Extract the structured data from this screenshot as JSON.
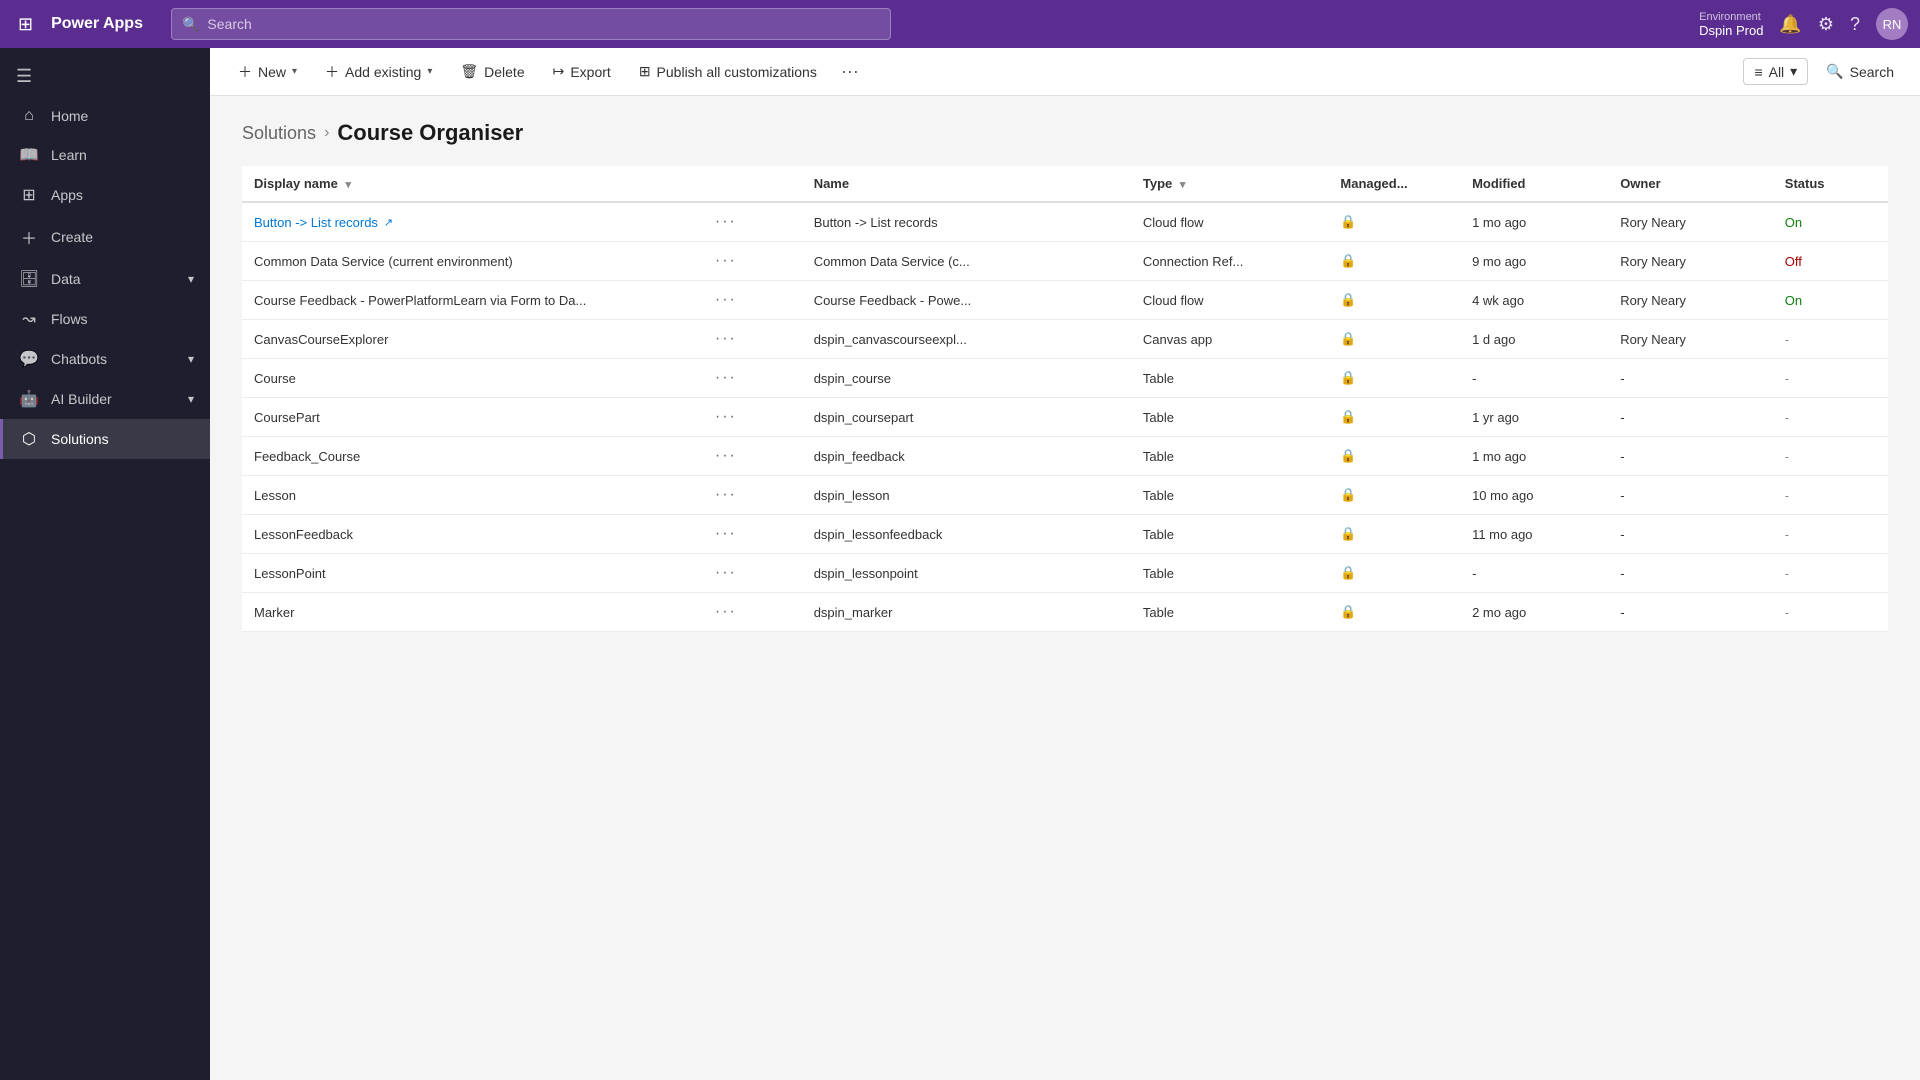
{
  "app": {
    "title": "Power Apps",
    "grid_icon": "⊞"
  },
  "topnav": {
    "search_placeholder": "Search",
    "environment_label": "Environment",
    "environment_name": "Dspin Prod",
    "avatar_initials": "RN"
  },
  "sidebar": {
    "toggle_icon": "☰",
    "items": [
      {
        "id": "home",
        "label": "Home",
        "icon": "⌂",
        "active": false
      },
      {
        "id": "learn",
        "label": "Learn",
        "icon": "📖",
        "active": false
      },
      {
        "id": "apps",
        "label": "Apps",
        "icon": "⊞",
        "active": false
      },
      {
        "id": "create",
        "label": "Create",
        "icon": "+",
        "active": false
      },
      {
        "id": "data",
        "label": "Data",
        "icon": "🗄",
        "active": false,
        "has_chevron": true
      },
      {
        "id": "flows",
        "label": "Flows",
        "icon": "↝",
        "active": false
      },
      {
        "id": "chatbots",
        "label": "Chatbots",
        "icon": "💬",
        "active": false,
        "has_chevron": true
      },
      {
        "id": "ai-builder",
        "label": "AI Builder",
        "icon": "🤖",
        "active": false,
        "has_chevron": true
      },
      {
        "id": "solutions",
        "label": "Solutions",
        "icon": "⬡",
        "active": true
      }
    ]
  },
  "cmdbar": {
    "new_label": "New",
    "add_existing_label": "Add existing",
    "delete_label": "Delete",
    "export_label": "Export",
    "publish_label": "Publish all customizations",
    "more_icon": "···",
    "filter_label": "All",
    "search_label": "Search"
  },
  "breadcrumb": {
    "parent": "Solutions",
    "current": "Course Organiser"
  },
  "table": {
    "columns": [
      {
        "id": "display_name",
        "label": "Display name",
        "sortable": true
      },
      {
        "id": "more",
        "label": ""
      },
      {
        "id": "name",
        "label": "Name"
      },
      {
        "id": "type",
        "label": "Type",
        "sortable": true
      },
      {
        "id": "managed",
        "label": "Managed..."
      },
      {
        "id": "modified",
        "label": "Modified"
      },
      {
        "id": "owner",
        "label": "Owner"
      },
      {
        "id": "status",
        "label": "Status"
      }
    ],
    "rows": [
      {
        "display_name": "Button -> List records",
        "is_link": true,
        "name": "Button -> List records",
        "type": "Cloud flow",
        "managed": true,
        "modified": "1 mo ago",
        "owner": "Rory Neary",
        "status": "On"
      },
      {
        "display_name": "Common Data Service (current environment)",
        "is_link": false,
        "name": "Common Data Service (c...",
        "type": "Connection Ref...",
        "managed": true,
        "modified": "9 mo ago",
        "owner": "Rory Neary",
        "status": "Off"
      },
      {
        "display_name": "Course Feedback - PowerPlatformLearn via Form to Da...",
        "is_link": false,
        "name": "Course Feedback - Powe...",
        "type": "Cloud flow",
        "managed": true,
        "modified": "4 wk ago",
        "owner": "Rory Neary",
        "status": "On"
      },
      {
        "display_name": "CanvasCourseExplorer",
        "is_link": false,
        "name": "dspin_canvascourseexpl...",
        "type": "Canvas app",
        "managed": true,
        "modified": "1 d ago",
        "owner": "Rory Neary",
        "status": "-"
      },
      {
        "display_name": "Course",
        "is_link": false,
        "name": "dspin_course",
        "type": "Table",
        "managed": true,
        "modified": "-",
        "owner": "-",
        "status": "-"
      },
      {
        "display_name": "CoursePart",
        "is_link": false,
        "name": "dspin_coursepart",
        "type": "Table",
        "managed": true,
        "modified": "1 yr ago",
        "owner": "-",
        "status": "-"
      },
      {
        "display_name": "Feedback_Course",
        "is_link": false,
        "name": "dspin_feedback",
        "type": "Table",
        "managed": true,
        "modified": "1 mo ago",
        "owner": "-",
        "status": "-"
      },
      {
        "display_name": "Lesson",
        "is_link": false,
        "name": "dspin_lesson",
        "type": "Table",
        "managed": true,
        "modified": "10 mo ago",
        "owner": "-",
        "status": "-"
      },
      {
        "display_name": "LessonFeedback",
        "is_link": false,
        "name": "dspin_lessonfeedback",
        "type": "Table",
        "managed": true,
        "modified": "11 mo ago",
        "owner": "-",
        "status": "-"
      },
      {
        "display_name": "LessonPoint",
        "is_link": false,
        "name": "dspin_lessonpoint",
        "type": "Table",
        "managed": true,
        "modified": "-",
        "owner": "-",
        "status": "-"
      },
      {
        "display_name": "Marker",
        "is_link": false,
        "name": "dspin_marker",
        "type": "Table",
        "managed": true,
        "modified": "2 mo ago",
        "owner": "-",
        "status": "-"
      }
    ]
  }
}
